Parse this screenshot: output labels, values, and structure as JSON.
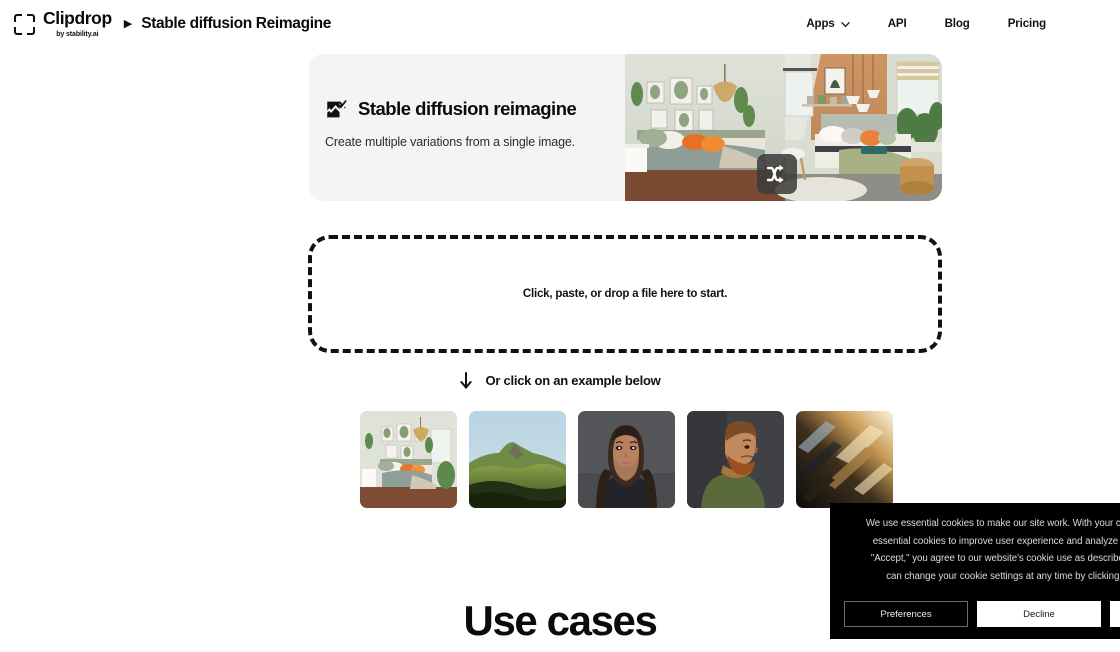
{
  "header": {
    "brand_name": "Clipdrop",
    "brand_sub": "by stability.ai",
    "separator": "▶",
    "breadcrumb_title": "Stable diffusion Reimagine",
    "nav": [
      {
        "label": "Apps",
        "has_chevron": true
      },
      {
        "label": "API",
        "has_chevron": false
      },
      {
        "label": "Blog",
        "has_chevron": false
      },
      {
        "label": "Pricing",
        "has_chevron": false
      }
    ]
  },
  "hero": {
    "icon": "image-shuffle-icon",
    "title": "Stable diffusion reimagine",
    "subtitle": "Create multiple variations from a single image.",
    "overlay_icon": "shuffle-icon",
    "background_color": "#f4f4f4",
    "image_alt": "Bedroom interior before and after variation"
  },
  "dropzone": {
    "text": "Click, paste, or drop a file here to start."
  },
  "examples": {
    "hint_icon": "arrow-down-icon",
    "hint_text": "Or click on an example below",
    "items": [
      {
        "name": "example-bedroom"
      },
      {
        "name": "example-mountain-landscape"
      },
      {
        "name": "example-woman-portrait"
      },
      {
        "name": "example-bearded-man"
      },
      {
        "name": "example-abstract-light"
      }
    ]
  },
  "section": {
    "use_cases_title": "Use cases"
  },
  "cookie_banner": {
    "line1": "We use essential cookies to make our site work. With your consent,",
    "line2": "essential cookies to improve user experience and analyze websi",
    "line3": "\"Accept,\" you agree to our website's cookie use as described in o",
    "line4": "can change your cookie settings at any time by clicking \"P",
    "buttons": [
      {
        "label": "Preferences",
        "style": "dark"
      },
      {
        "label": "Decline",
        "style": "light"
      }
    ],
    "background_color": "#000000"
  }
}
